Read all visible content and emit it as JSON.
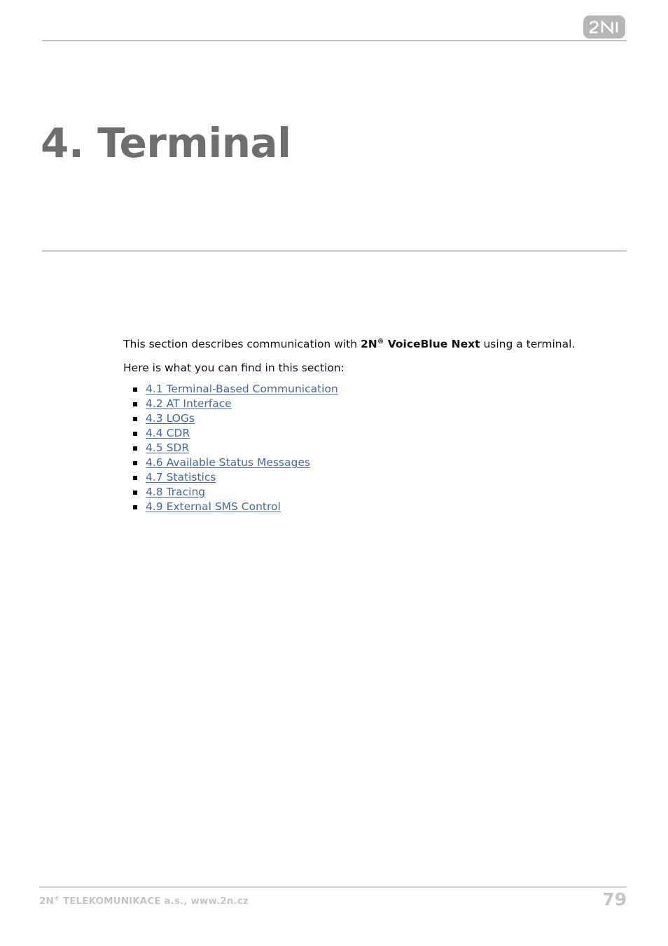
{
  "document": {
    "page_number": "79"
  },
  "header": {
    "logo_text": "2N",
    "logo_name": "2n-logo",
    "logo_color": "#b6b6b6"
  },
  "title": {
    "text": "4. Terminal",
    "color": "#6e6e6e"
  },
  "body": {
    "intro_part1": "This section describes communication with ",
    "intro_brand": "2N",
    "intro_brand_sup": "®",
    "intro_brand_rest": " VoiceBlue Next",
    "intro_part2": " using a terminal.",
    "intro_full": "This section describes communication with 2N® VoiceBlue Next using a terminal.",
    "lead_in": "Here is what you can find in this section:"
  },
  "toc": {
    "link_color": "#45679c",
    "items": [
      {
        "label": "4.1 Terminal-Based Communication"
      },
      {
        "label": "4.2 AT Interface"
      },
      {
        "label": "4.3 LOGs"
      },
      {
        "label": "4.4 CDR"
      },
      {
        "label": "4.5 SDR"
      },
      {
        "label": "4.6 Available Status Messages"
      },
      {
        "label": "4.7 Statistics"
      },
      {
        "label": "4.8 Tracing"
      },
      {
        "label": "4.9 External SMS Control"
      }
    ]
  },
  "footer": {
    "company_prefix": "2N",
    "company_sup": "®",
    "company_rest": " TELEKOMUNIKACE a.s., www.2n.cz",
    "company_full": "2N® TELEKOMUNIKACE a.s., www.2n.cz",
    "page_number": "79",
    "color": "#c4c4c4"
  }
}
